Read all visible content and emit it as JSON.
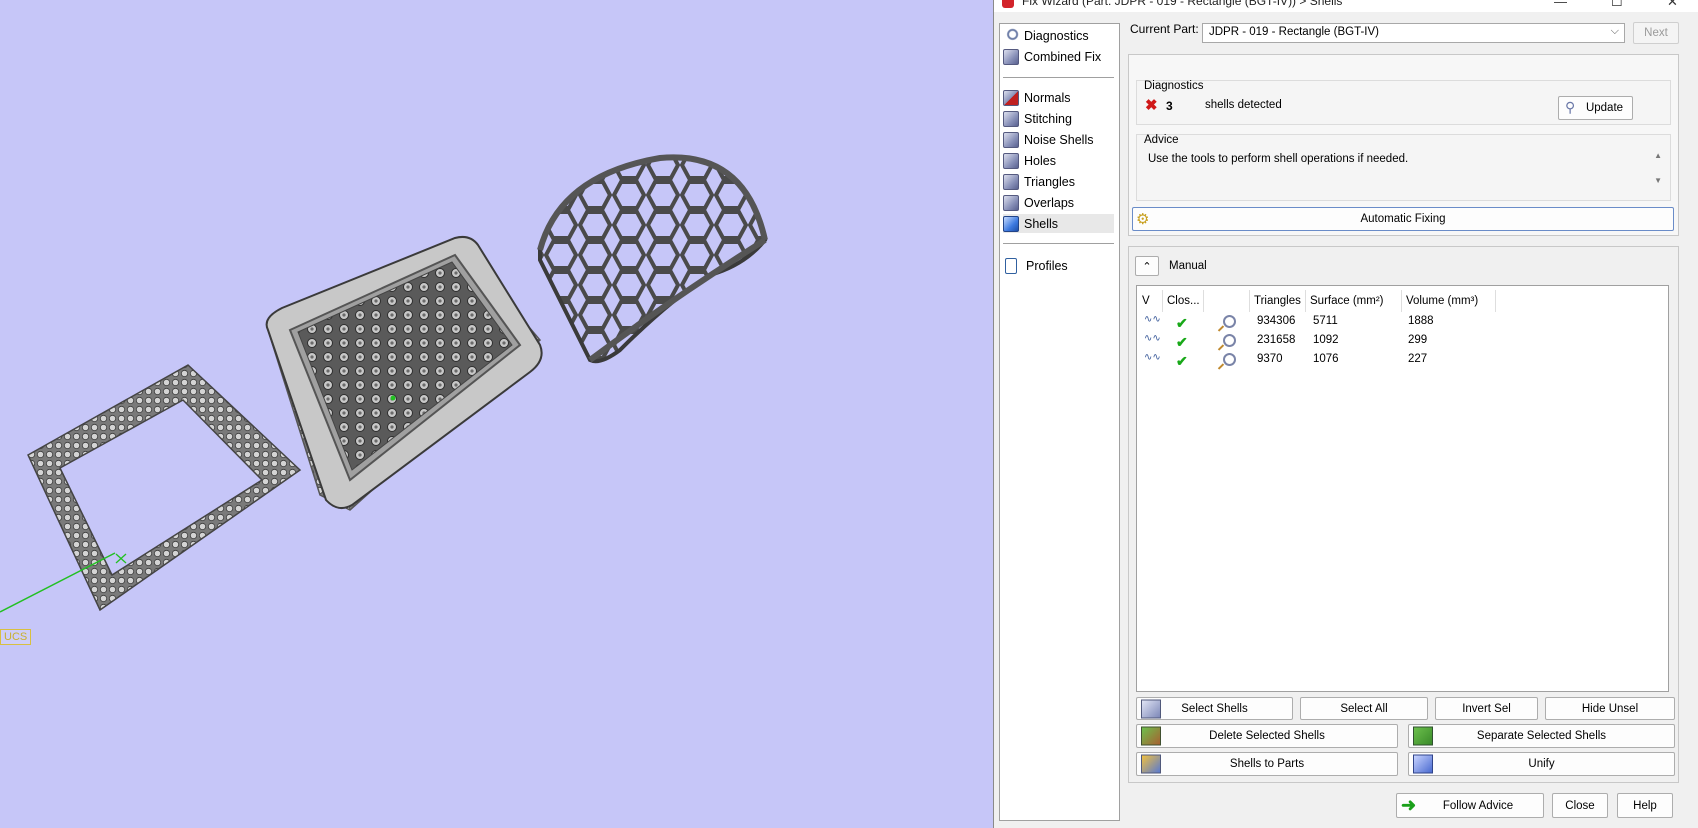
{
  "window": {
    "title": "Fix Wizard (Part: JDPR - 019 - Rectangle (BGT-IV)) > Shells"
  },
  "viewport": {
    "ucs_label": "UCS"
  },
  "nav": {
    "items": [
      {
        "label": "Diagnostics",
        "icon": "diagnostics-icon"
      },
      {
        "label": "Combined Fix",
        "icon": "combined-fix-icon"
      },
      {
        "label": "Normals",
        "icon": "normals-icon"
      },
      {
        "label": "Stitching",
        "icon": "stitching-icon"
      },
      {
        "label": "Noise Shells",
        "icon": "noise-shells-icon"
      },
      {
        "label": "Holes",
        "icon": "holes-icon"
      },
      {
        "label": "Triangles",
        "icon": "triangles-icon"
      },
      {
        "label": "Overlaps",
        "icon": "overlaps-icon"
      },
      {
        "label": "Shells",
        "icon": "shells-icon"
      },
      {
        "label": "Profiles",
        "icon": "profiles-icon"
      }
    ],
    "selected": "Shells"
  },
  "header": {
    "current_part_label": "Current Part:",
    "current_part_value": "JDPR - 019 - Rectangle (BGT-IV)",
    "next_label": "Next"
  },
  "diagnostics": {
    "label": "Diagnostics",
    "count": "3",
    "message": "shells detected",
    "update_label": "Update"
  },
  "advice": {
    "label": "Advice",
    "text": "Use the tools to perform shell operations if needed.",
    "automatic_fixing_label": "Automatic Fixing"
  },
  "manual": {
    "label": "Manual",
    "columns": [
      "V",
      "Clos...",
      "",
      "Triangles",
      "Surface (mm²)",
      "Volume (mm³)"
    ],
    "rows": [
      {
        "triangles": "934306",
        "surface": "5711",
        "volume": "1888"
      },
      {
        "triangles": "231658",
        "surface": "1092",
        "volume": "299"
      },
      {
        "triangles": "9370",
        "surface": "1076",
        "volume": "227"
      }
    ]
  },
  "actions": {
    "select_shells": "Select Shells",
    "select_all": "Select All",
    "invert_sel": "Invert Sel",
    "hide_unsel": "Hide Unsel",
    "delete_selected": "Delete Selected Shells",
    "separate_selected": "Separate Selected Shells",
    "shells_to_parts": "Shells to Parts",
    "unify": "Unify"
  },
  "footer": {
    "follow_advice": "Follow Advice",
    "close": "Close",
    "help": "Help"
  },
  "colors": {
    "viewport_bg": "#c6c6f8",
    "dialog_bg": "#f0f0f0",
    "check_green": "#18a818",
    "error_red": "#d01818"
  }
}
